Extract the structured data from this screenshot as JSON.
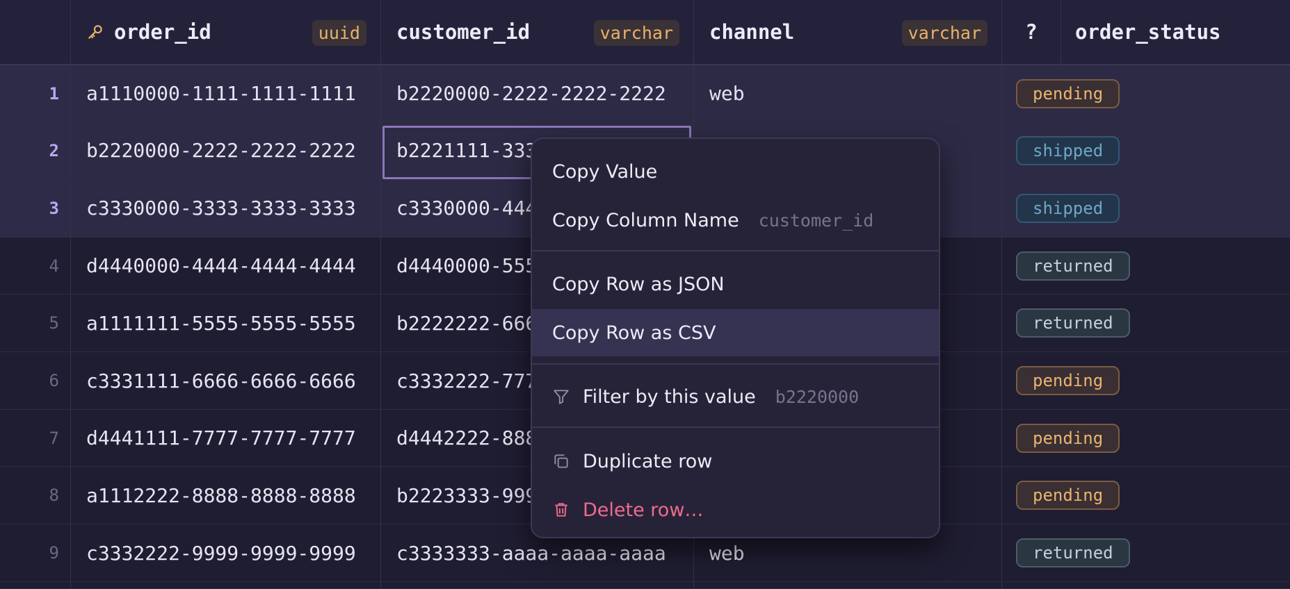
{
  "columns": {
    "order_id": {
      "name": "order_id",
      "type": "uuid"
    },
    "customer_id": {
      "name": "customer_id",
      "type": "varchar"
    },
    "channel": {
      "name": "channel",
      "type": "varchar"
    },
    "unknown_type": "?",
    "order_status": {
      "name": "order_status"
    }
  },
  "rows": [
    {
      "n": "1",
      "order_id": "a1110000-1111-1111-1111",
      "customer_id": "b2220000-2222-2222-2222",
      "channel": "web",
      "status": "pending"
    },
    {
      "n": "2",
      "order_id": "b2220000-2222-2222-2222",
      "customer_id": "b2221111-333",
      "channel": "",
      "status": "shipped"
    },
    {
      "n": "3",
      "order_id": "c3330000-3333-3333-3333",
      "customer_id": "c3330000-444",
      "channel": "",
      "status": "shipped"
    },
    {
      "n": "4",
      "order_id": "d4440000-4444-4444-4444",
      "customer_id": "d4440000-555",
      "channel": "",
      "status": "returned"
    },
    {
      "n": "5",
      "order_id": "a1111111-5555-5555-5555",
      "customer_id": "b2222222-666",
      "channel": "",
      "status": "returned"
    },
    {
      "n": "6",
      "order_id": "c3331111-6666-6666-6666",
      "customer_id": "c3332222-777",
      "channel": "",
      "status": "pending"
    },
    {
      "n": "7",
      "order_id": "d4441111-7777-7777-7777",
      "customer_id": "d4442222-888",
      "channel": "",
      "status": "pending"
    },
    {
      "n": "8",
      "order_id": "a1112222-8888-8888-8888",
      "customer_id": "b2223333-999",
      "channel": "",
      "status": "pending"
    },
    {
      "n": "9",
      "order_id": "c3332222-9999-9999-9999",
      "customer_id": "c3333333-aaaa-aaaa-aaaa",
      "channel": "web",
      "status": "returned"
    }
  ],
  "context_menu": {
    "copy_value": "Copy Value",
    "copy_column_name": "Copy Column Name",
    "copy_column_name_hint": "customer_id",
    "copy_row_json": "Copy Row as JSON",
    "copy_row_csv": "Copy Row as CSV",
    "filter_by_value": "Filter by this value",
    "filter_by_value_hint": "b2220000",
    "duplicate_row": "Duplicate row",
    "delete_row": "Delete row…"
  },
  "colors": {
    "background": "#1f1d30",
    "type_tag": "#e8b26a",
    "pending": "#eab56f",
    "shipped": "#6ea7c8",
    "returned": "#c2d2da",
    "danger": "#f06a8e",
    "selection": "#8a77b8"
  },
  "icons": {
    "primary_key": "key-icon",
    "filter": "filter-icon",
    "duplicate": "copy-icon",
    "delete": "trash-icon"
  }
}
